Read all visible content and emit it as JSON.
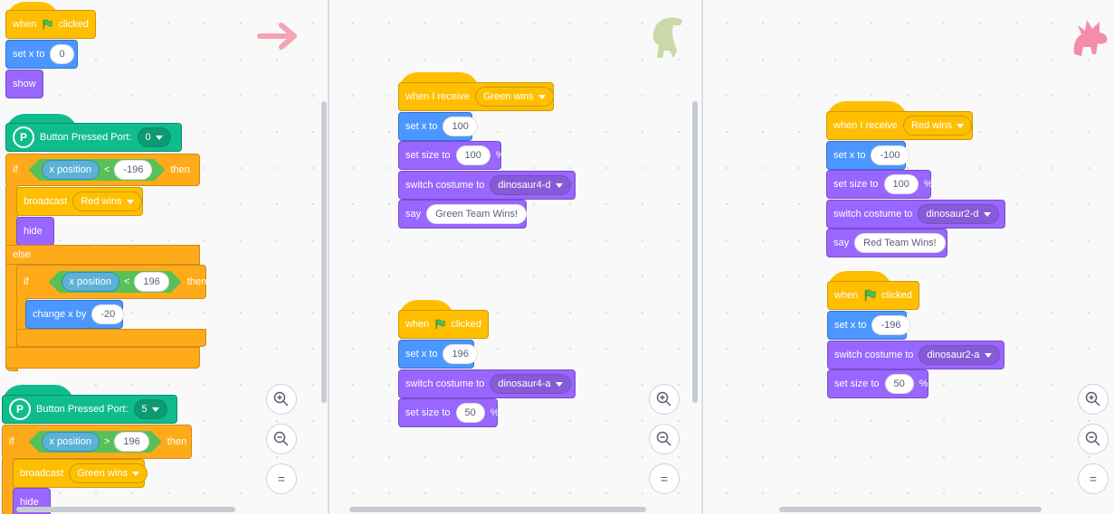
{
  "colors": {
    "events": "#ffbf00",
    "motion": "#4c97ff",
    "looks": "#9966ff",
    "control": "#ffab19",
    "extension": "#0fbd8c",
    "operator": "#59c059",
    "sensing": "#5cb1d6"
  },
  "pane1": {
    "flag_script": {
      "when": "when",
      "clicked": "clicked",
      "set_x": "set x to",
      "x_value": "0",
      "show": "show"
    },
    "button_script_1": {
      "label": "Button Pressed Port:",
      "port": "0",
      "if": "if",
      "then": "then",
      "x_position": "x position",
      "op": "<",
      "value": "-196",
      "broadcast": "broadcast",
      "message": "Red wins",
      "hide": "hide",
      "else": "else",
      "if2": "if",
      "then2": "then",
      "x_position2": "x position",
      "op2": "<",
      "value2": "196",
      "change_x": "change x by",
      "change_value": "-20"
    },
    "button_script_2": {
      "label": "Button Pressed Port:",
      "port": "5",
      "if": "if",
      "then": "then",
      "x_position": "x position",
      "op": ">",
      "value": "196",
      "broadcast": "broadcast",
      "message": "Green wins",
      "hide": "hide"
    },
    "sprite_icon": "arrow-sprite-icon"
  },
  "pane2": {
    "receive_script": {
      "when_receive": "when I receive",
      "message": "Green wins",
      "set_x": "set x to",
      "x_value": "100",
      "set_size": "set size to",
      "size_value": "100",
      "percent": "%",
      "switch_costume": "switch costume to",
      "costume": "dinosaur4-d",
      "say": "say",
      "say_text": "Green Team Wins!"
    },
    "flag_script": {
      "when": "when",
      "clicked": "clicked",
      "set_x": "set x to",
      "x_value": "196",
      "switch_costume": "switch costume to",
      "costume": "dinosaur4-a",
      "set_size": "set size to",
      "size_value": "50",
      "percent": "%"
    },
    "sprite_icon": "green-dinosaur-sprite-icon"
  },
  "pane3": {
    "receive_script": {
      "when_receive": "when I receive",
      "message": "Red wins",
      "set_x": "set x to",
      "x_value": "-100",
      "set_size": "set size to",
      "size_value": "100",
      "percent": "%",
      "switch_costume": "switch costume to",
      "costume": "dinosaur2-d",
      "say": "say",
      "say_text": "Red Team Wins!"
    },
    "flag_script": {
      "when": "when",
      "clicked": "clicked",
      "set_x": "set x to",
      "x_value": "-196",
      "switch_costume": "switch costume to",
      "costume": "dinosaur2-a",
      "set_size": "set size to",
      "size_value": "50",
      "percent": "%"
    },
    "sprite_icon": "pink-dinosaur-sprite-icon"
  },
  "zoom": {
    "zoom_in": "+",
    "zoom_out": "−",
    "reset": "="
  }
}
